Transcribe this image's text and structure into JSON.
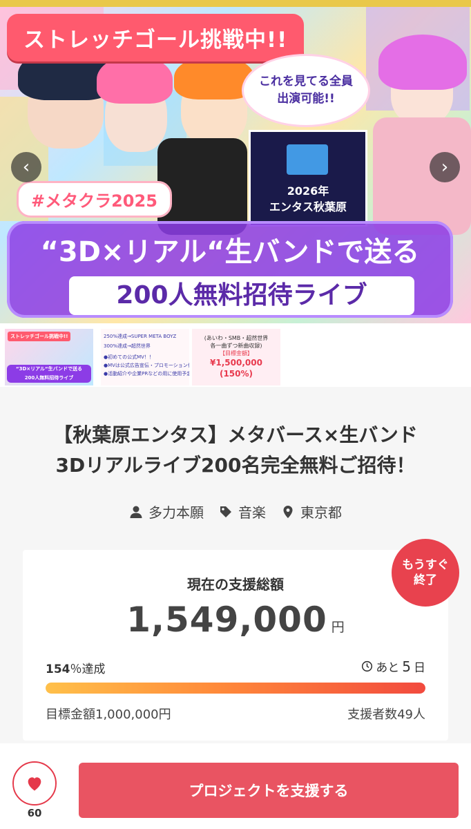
{
  "hero": {
    "stretch_goal": "ストレッチゴール挑戦中!!",
    "bubble_line1": "これを見てる全員",
    "bubble_line2": "出演可能!!",
    "hashtag": "#メタクラ2025",
    "stage_line1": "2026年",
    "stage_line2": "エンタス秋葉原",
    "banner_line1": "“3D×リアル“生バンドで送る",
    "banner_line2": "200人無料招待ライブ",
    "prev_icon": "chevron-left-icon",
    "next_icon": "chevron-right-icon"
  },
  "thumbnails": {
    "t1_top": "ストレッチゴール挑戦中!!",
    "t1_band1": "“3D×リアル“生バンドで送る",
    "t1_band2": "200人無料招待ライブ",
    "t2_lines": [
      "250%達成→SUPER META BOYZ",
      "300%達成→超然世界",
      "●初めての公式MV！！",
      "●MVは公式広告宣伝・プロモーション付き",
      "●活動紹介や企業PRなどの用に使用予定"
    ],
    "t3_lines": [
      "(あいわ・SMB・超然世界",
      "各一曲ずつ新曲収録)",
      "【目標金額】"
    ],
    "t3_price": "¥1,500,000",
    "t3_pct": "(150%)"
  },
  "project": {
    "title_line1": "【秋葉原エンタス】メタバース×生バンド",
    "title_line2": "3Dリアルライブ200名完全無料ご招待！",
    "owner": "多力本願",
    "category": "音楽",
    "location": "東京都"
  },
  "funding": {
    "label": "現在の支援総額",
    "amount": "1,549,000",
    "currency": "円",
    "percent": "154",
    "percent_suffix": "％達成",
    "remaining_prefix": "あと",
    "remaining_days": "5",
    "remaining_unit": "日",
    "progress": 1.0,
    "goal": "目標金額1,000,000円",
    "backers": "支援者数49人",
    "badge_line1": "もうすぐ",
    "badge_line2": "終了"
  },
  "actions": {
    "favorite_count": "60",
    "support_button": "プロジェクトを支援する"
  },
  "colors": {
    "accent": "#e95462",
    "badge": "#e8424e",
    "banner": "#8c3ce6"
  }
}
